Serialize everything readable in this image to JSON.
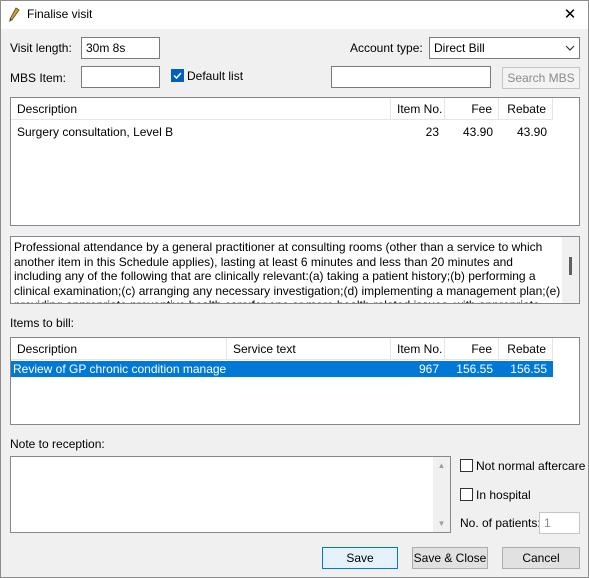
{
  "window": {
    "title": "Finalise visit",
    "close_glyph": "✕"
  },
  "visit": {
    "length_label": "Visit length:",
    "length_value": "30m  8s",
    "account_label": "Account type:",
    "account_value": "Direct Bill",
    "mbs_label": "MBS Item:",
    "mbs_value": "",
    "default_list_label": "Default list",
    "default_list_checked": true,
    "search_value": "",
    "search_button": "Search MBS"
  },
  "mbs_table": {
    "columns": [
      "Description",
      "Item No.",
      "Fee",
      "Rebate"
    ],
    "rows": [
      {
        "description": "Surgery consultation, Level B",
        "item_no": "23",
        "fee": "43.90",
        "rebate": "43.90"
      }
    ]
  },
  "item_description": "Professional attendance by a general practitioner at consulting rooms (other than a service to which another item in this Schedule applies), lasting at least 6 minutes and less than 20 minutes and including any of the following that are clinically relevant:(a) taking a patient history;(b) performing a clinical examination;(c) arranging any necessary investigation;(d) implementing a management plan;(e) providing appropriate preventive health care;for one or more health-related issues, with appropriate documentation.",
  "bill": {
    "label": "Items to bill:",
    "columns": [
      "Description",
      "Service text",
      "Item No.",
      "Fee",
      "Rebate"
    ],
    "rows": [
      {
        "description": "Review of GP chronic condition management",
        "service_text": "",
        "item_no": "967",
        "fee": "156.55",
        "rebate": "156.55"
      }
    ]
  },
  "reception": {
    "label": "Note to reception:",
    "note": "",
    "not_normal_aftercare": "Not normal aftercare",
    "in_hospital": "In hospital",
    "patients_label": "No. of patients:",
    "patients_value": "1"
  },
  "buttons": {
    "save": "Save",
    "save_close": "Save & Close",
    "cancel": "Cancel"
  }
}
